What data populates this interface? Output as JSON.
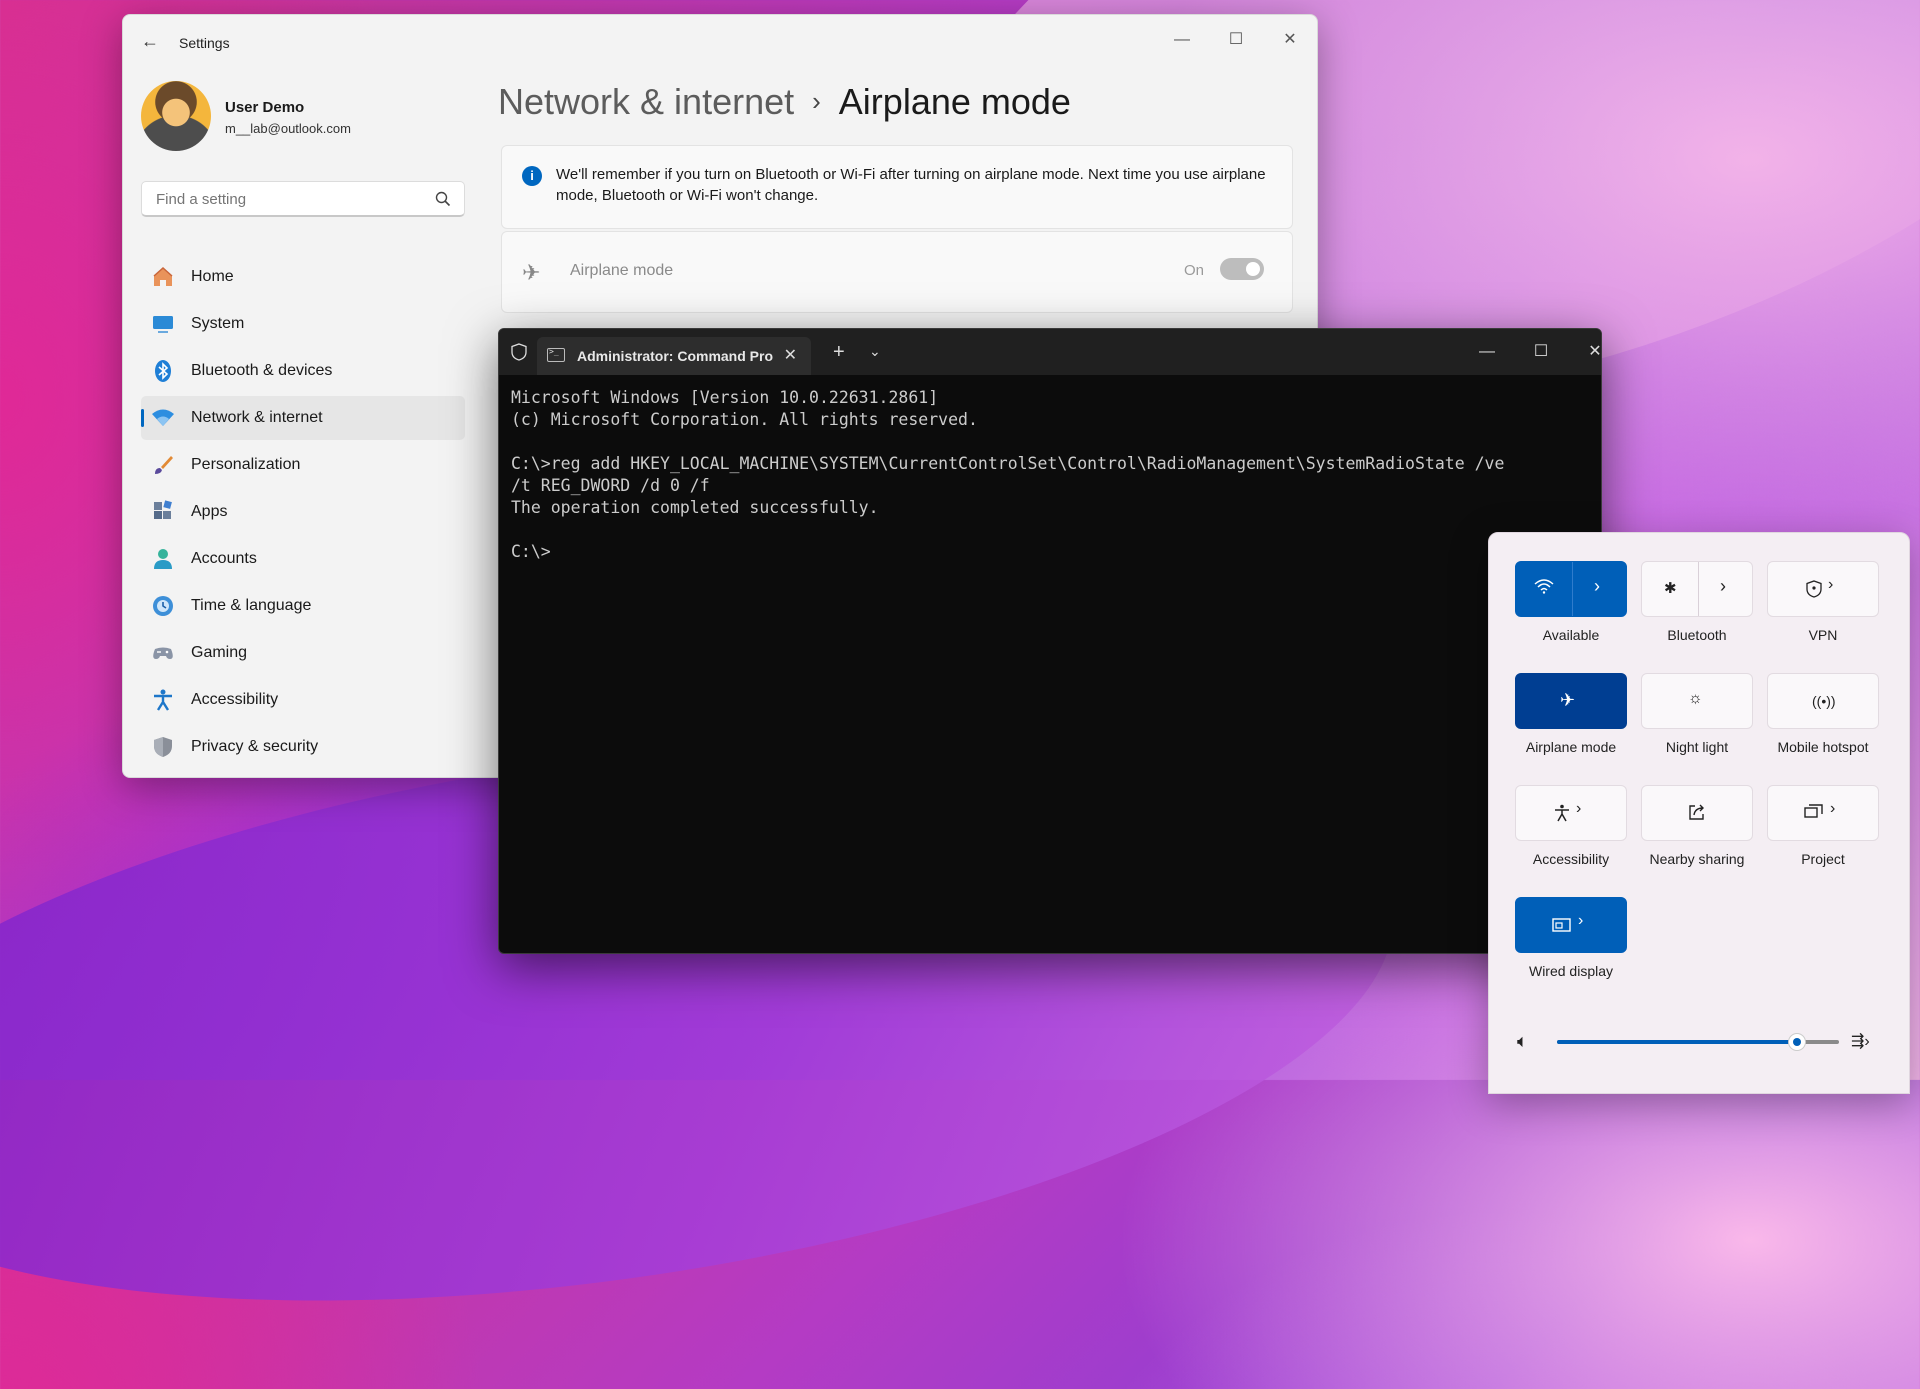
{
  "settings": {
    "app_title": "Settings",
    "back": "←",
    "ctrl_min": "—",
    "ctrl_max": "☐",
    "ctrl_close": "✕",
    "user_name": "User Demo",
    "user_email": "m__lab@outlook.com",
    "search_placeholder": "Find a setting",
    "nav": [
      {
        "label": "Home",
        "icon": "home-icon"
      },
      {
        "label": "System",
        "icon": "system-icon"
      },
      {
        "label": "Bluetooth & devices",
        "icon": "bluetooth-icon"
      },
      {
        "label": "Network & internet",
        "icon": "network-icon",
        "active": true
      },
      {
        "label": "Personalization",
        "icon": "brush-icon"
      },
      {
        "label": "Apps",
        "icon": "apps-icon"
      },
      {
        "label": "Accounts",
        "icon": "accounts-icon"
      },
      {
        "label": "Time & language",
        "icon": "clock-icon"
      },
      {
        "label": "Gaming",
        "icon": "gamepad-icon"
      },
      {
        "label": "Accessibility",
        "icon": "accessibility-icon"
      },
      {
        "label": "Privacy & security",
        "icon": "shield-icon"
      }
    ],
    "breadcrumb_parent": "Network & internet",
    "breadcrumb_sep": "›",
    "breadcrumb_current": "Airplane mode",
    "info_text": "We'll remember if you turn on Bluetooth or Wi-Fi after turning on airplane mode. Next time you use airplane mode, Bluetooth or Wi-Fi won't change.",
    "airplane_label": "Airplane mode",
    "airplane_state": "On",
    "airplane_on": true
  },
  "terminal": {
    "tab_title": "Administrator: Command Pro",
    "tab_close": "✕",
    "new_tab": "+",
    "dropdown": "⌄",
    "ctrl_min": "—",
    "ctrl_max": "☐",
    "ctrl_close": "✕",
    "output": "Microsoft Windows [Version 10.0.22631.2861]\n(c) Microsoft Corporation. All rights reserved.\n\nC:\\>reg add HKEY_LOCAL_MACHINE\\SYSTEM\\CurrentControlSet\\Control\\RadioManagement\\SystemRadioState /ve\n/t REG_DWORD /d 0 /f\nThe operation completed successfully.\n\nC:\\>"
  },
  "quick_settings": {
    "tiles": [
      {
        "label": "Available",
        "icon": "wifi-icon",
        "state": "on"
      },
      {
        "label": "Bluetooth",
        "icon": "bluetooth-icon",
        "state": "off"
      },
      {
        "label": "VPN",
        "icon": "vpn-shield-icon",
        "state": "off"
      },
      {
        "label": "Airplane mode",
        "icon": "airplane-icon",
        "state": "on-dark"
      },
      {
        "label": "Night light",
        "icon": "sun-icon",
        "state": "off"
      },
      {
        "label": "Mobile hotspot",
        "icon": "hotspot-icon",
        "state": "off"
      },
      {
        "label": "Accessibility",
        "icon": "accessibility-icon",
        "state": "off"
      },
      {
        "label": "Nearby sharing",
        "icon": "share-icon",
        "state": "off"
      },
      {
        "label": "Project",
        "icon": "project-icon",
        "state": "off"
      },
      {
        "label": "Wired display",
        "icon": "cast-icon",
        "state": "on"
      }
    ],
    "volume_fraction": 0.85,
    "colors": {
      "accent": "#005fb8",
      "accent_dark": "#003e92"
    }
  }
}
